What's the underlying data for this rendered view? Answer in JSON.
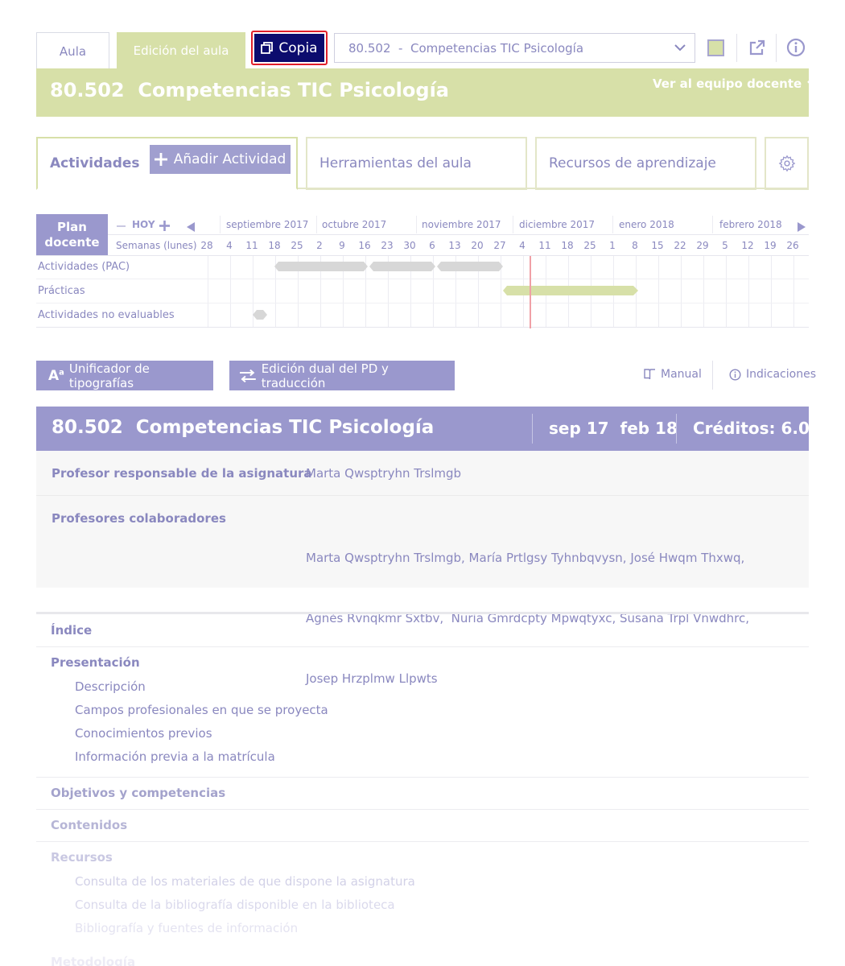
{
  "tabs": {
    "aula": "Aula",
    "edicion": "Edición del aula",
    "copia": "Copia"
  },
  "course_select": {
    "value": "80.502  -  Competencias TIC Psicología"
  },
  "banner": {
    "title": "80.502  Competencias TIC Psicología",
    "team_link": "Ver al equipo docente"
  },
  "section_tabs": {
    "actividades": "Actividades",
    "add_activity": "Añadir Actividad",
    "herramientas": "Herramientas del aula",
    "recursos": "Recursos de aprendizaje"
  },
  "timeline": {
    "plan_title_1": "Plan",
    "plan_title_2": "docente",
    "today_label": "HOY",
    "weeks_label": "Semanas (lunes)",
    "months": [
      "septiembre 2017",
      "octubre 2017",
      "noviembre 2017",
      "diciembre 2017",
      "enero 2018",
      "febrero 2018"
    ],
    "weeks": [
      "28",
      "4",
      "11",
      "18",
      "25",
      "2",
      "9",
      "16",
      "23",
      "30",
      "6",
      "13",
      "20",
      "27",
      "4",
      "11",
      "18",
      "25",
      "1",
      "8",
      "15",
      "22",
      "29",
      "5",
      "12",
      "19",
      "26"
    ],
    "rows": [
      "Actividades (PAC)",
      "Prácticas",
      "Actividades no evaluables"
    ]
  },
  "actions": {
    "unificador": "Unificador de tipografías",
    "edicion_dual": "Edición dual del PD y traducción",
    "manual": "Manual",
    "indicaciones": "Indicaciones"
  },
  "course": {
    "title": "80.502  Competencias TIC Psicología",
    "dates": "sep 17  feb 18",
    "credits": "Créditos: 6.0",
    "responsable_label": "Profesor responsable de la asignatura",
    "responsable_value": "Marta Qwsptryhn Trslmgb",
    "colaboradores_label": "Profesores colaboradores",
    "colaboradores_line1": "Marta Qwsptryhn Trslmgb, María Prtlgsy Tyhnbqvysn, José Hwqm Thxwq,",
    "colaboradores_line2": "Agnès Rvnqkmr Sxtbv,  Nuria Gmrdcpty Mpwqtyxc, Susana Trpl Vnwdhrc,",
    "colaboradores_line3": "Josep Hrzplmw Llpwts"
  },
  "index": {
    "indice": "Índice",
    "presentacion": "Presentación",
    "presentacion_items": [
      "Descripción",
      "Campos profesionales en que se proyecta",
      "Conocimientos previos",
      "Información previa a la matrícula"
    ],
    "objetivos": "Objetivos y competencias",
    "contenidos": "Contenidos",
    "recursos": "Recursos",
    "recursos_items": [
      "Consulta de los materiales de que dispone la asignatura",
      "Consulta de la bibliografía disponible en la biblioteca",
      "Bibliografía y fuentes de información"
    ],
    "metodologia": "Metodología"
  },
  "colors": {
    "lime": "#d7e0a8",
    "purple": "#9a98cd",
    "navy": "#0c0c6e",
    "text": "#8a88bf",
    "today": "#f0a0a6"
  }
}
